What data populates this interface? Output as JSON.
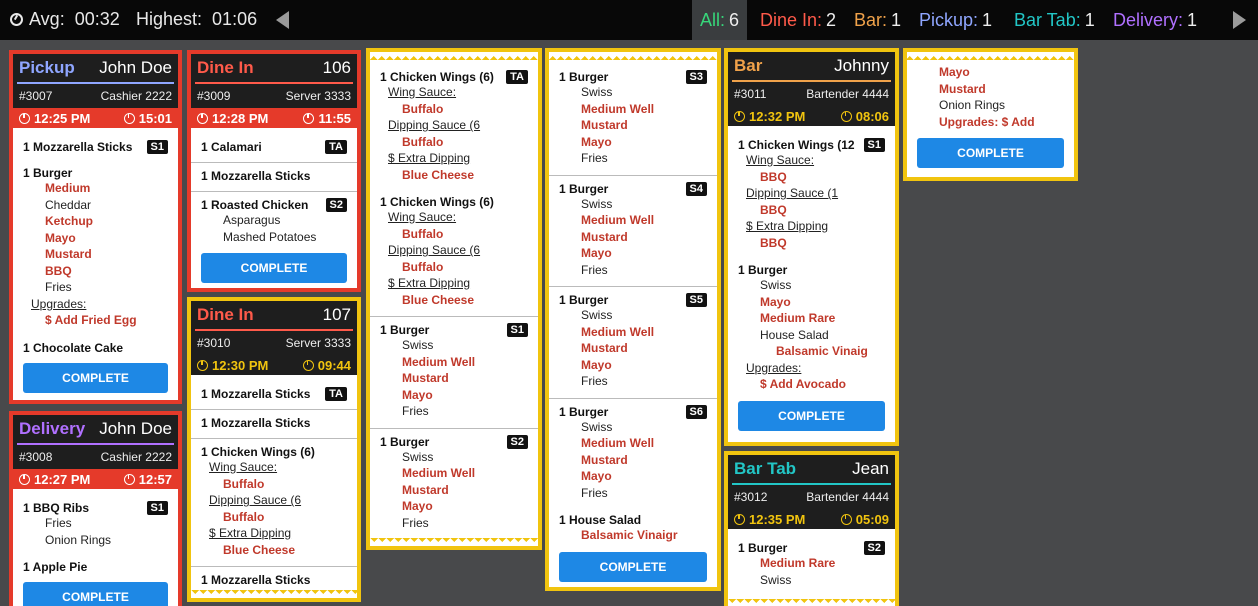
{
  "topbar": {
    "avg_label": "Avg:",
    "avg_value": "00:32",
    "highest_label": "Highest:",
    "highest_value": "01:06",
    "filters": [
      {
        "label": "All:",
        "count": "6",
        "color": "#37d67a"
      },
      {
        "label": "Dine In:",
        "count": "2",
        "color": "#ff5a4a"
      },
      {
        "label": "Bar:",
        "count": "1",
        "color": "#f0a24a"
      },
      {
        "label": "Pickup:",
        "count": "1",
        "color": "#8fa6ff"
      },
      {
        "label": "Bar Tab:",
        "count": "1",
        "color": "#22c6c6"
      },
      {
        "label": "Delivery:",
        "count": "1",
        "color": "#b070ff"
      }
    ]
  },
  "tickets": {
    "pickup": {
      "type": "Pickup",
      "type_color": "#8fa6ff",
      "customer": "John Doe",
      "order": "#3007",
      "staff": "Cashier 2222",
      "time": "12:25 PM",
      "timer": "15:01",
      "items": [
        {
          "name": "1 Mozzarella Sticks",
          "badge": "S1"
        },
        {
          "name": "1 Burger",
          "mods_red": [
            "Medium"
          ],
          "mods_plain1": [
            "Cheddar"
          ],
          "mods_red2": [
            "Ketchup",
            "Mayo",
            "Mustard",
            "BBQ"
          ],
          "mods_plain2": [
            "Fries"
          ],
          "upgrades": "Upgrades:",
          "upgrade_item": "$ Add Fried Egg"
        },
        {
          "name": "1 Chocolate Cake"
        }
      ],
      "complete": "COMPLETE"
    },
    "delivery": {
      "type": "Delivery",
      "type_color": "#b070ff",
      "customer": "John Doe",
      "order": "#3008",
      "staff": "Cashier 2222",
      "time": "12:27 PM",
      "timer": "12:57",
      "items": [
        {
          "name": "1 BBQ Ribs",
          "badge": "S1",
          "mods": [
            "Fries",
            "Onion Rings"
          ]
        },
        {
          "name": "1 Apple Pie"
        }
      ],
      "complete": "COMPLETE"
    },
    "dine106": {
      "type": "Dine In",
      "type_color": "#ff5a4a",
      "customer": "106",
      "order": "#3009",
      "staff": "Server 3333",
      "time": "12:28 PM",
      "timer": "11:55",
      "items": [
        {
          "name": "1 Calamari",
          "badge": "TA"
        },
        {
          "name": "1 Mozzarella Sticks"
        },
        {
          "name": "1 Roasted Chicken",
          "badge": "S2",
          "mods": [
            "Asparagus",
            "Mashed Potatoes"
          ]
        }
      ],
      "complete": "COMPLETE"
    },
    "dine107": {
      "type": "Dine In",
      "type_color": "#ff5a4a",
      "customer": "107",
      "order": "#3010",
      "staff": "Server 3333",
      "time": "12:30 PM",
      "timer": "09:44",
      "items": [
        {
          "name": "1 Mozzarella Sticks",
          "badge": "TA"
        },
        {
          "name": "1 Mozzarella Sticks"
        },
        {
          "name": "1 Chicken Wings (6)",
          "sub1": "Wing Sauce:",
          "val1": "Buffalo",
          "sub2": "Dipping Sauce (6",
          "val2": "Buffalo",
          "sub3": "$ Extra Dipping",
          "val3": "Blue Cheese"
        },
        {
          "name": "1 Mozzarella Sticks"
        }
      ]
    },
    "cont107": {
      "items": [
        {
          "name": "1 Chicken Wings (6)",
          "badge": "TA",
          "sub1": "Wing Sauce:",
          "val1": "Buffalo",
          "sub2": "Dipping Sauce (6",
          "val2": "Buffalo",
          "sub3": "$ Extra Dipping",
          "val3": "Blue Cheese"
        },
        {
          "name": "1 Chicken Wings (6)",
          "sub1": "Wing Sauce:",
          "val1": "Buffalo",
          "sub2": "Dipping Sauce (6",
          "val2": "Buffalo",
          "sub3": "$ Extra Dipping",
          "val3": "Blue Cheese"
        },
        {
          "name": "1 Burger",
          "badge": "S1",
          "mods": [
            "Swiss"
          ],
          "red": [
            "Medium Well",
            "Mustard",
            "Mayo"
          ],
          "after": [
            "Fries"
          ]
        },
        {
          "name": "1 Burger",
          "badge": "S2",
          "mods": [
            "Swiss"
          ],
          "red": [
            "Medium Well",
            "Mustard",
            "Mayo"
          ],
          "after": [
            "Fries"
          ]
        }
      ]
    },
    "cont107b": {
      "items": [
        {
          "name": "1 Burger",
          "badge": "S3",
          "mods": [
            "Swiss"
          ],
          "red": [
            "Medium Well",
            "Mustard",
            "Mayo"
          ],
          "after": [
            "Fries"
          ]
        },
        {
          "name": "1 Burger",
          "badge": "S4",
          "mods": [
            "Swiss"
          ],
          "red": [
            "Medium Well",
            "Mustard",
            "Mayo"
          ],
          "after": [
            "Fries"
          ]
        },
        {
          "name": "1 Burger",
          "badge": "S5",
          "mods": [
            "Swiss"
          ],
          "red": [
            "Medium Well",
            "Mustard",
            "Mayo"
          ],
          "after": [
            "Fries"
          ]
        },
        {
          "name": "1 Burger",
          "badge": "S6",
          "mods": [
            "Swiss"
          ],
          "red": [
            "Medium Well",
            "Mustard",
            "Mayo"
          ],
          "after": [
            "Fries"
          ]
        },
        {
          "name": "1 House Salad",
          "red": [
            "Balsamic Vinaigr"
          ]
        }
      ],
      "complete": "COMPLETE"
    },
    "bar": {
      "type": "Bar",
      "type_color": "#f0a24a",
      "customer": "Johnny",
      "order": "#3011",
      "staff": "Bartender 4444",
      "time": "12:32 PM",
      "timer": "08:06",
      "items": [
        {
          "name": "1 Chicken Wings (12",
          "badge": "S1",
          "sub1": "Wing Sauce:",
          "val1": "BBQ",
          "sub2": "Dipping Sauce (1",
          "val2": "BBQ",
          "sub3": "$ Extra Dipping",
          "val3": "BBQ"
        },
        {
          "name": "1 Burger",
          "mods": [
            "Swiss"
          ],
          "red": [
            "Mayo",
            "Medium Rare"
          ],
          "after": [
            "House Salad"
          ],
          "red2": "Balsamic Vinaig",
          "upgrades": "Upgrades:",
          "upgrade_item": "$ Add Avocado"
        }
      ],
      "complete": "COMPLETE"
    },
    "bartab": {
      "type": "Bar Tab",
      "type_color": "#22c6c6",
      "customer": "Jean",
      "order": "#3012",
      "staff": "Bartender 4444",
      "time": "12:35 PM",
      "timer": "05:09",
      "items": [
        {
          "name": "1 Burger",
          "badge": "S2",
          "red": [
            "Medium Rare"
          ],
          "after": [
            "Swiss"
          ]
        }
      ]
    },
    "contbar": {
      "red1": [
        "Mayo",
        "Mustard"
      ],
      "plain": "Onion Rings",
      "red2": "Upgrades: $ Add",
      "complete": "COMPLETE"
    }
  }
}
